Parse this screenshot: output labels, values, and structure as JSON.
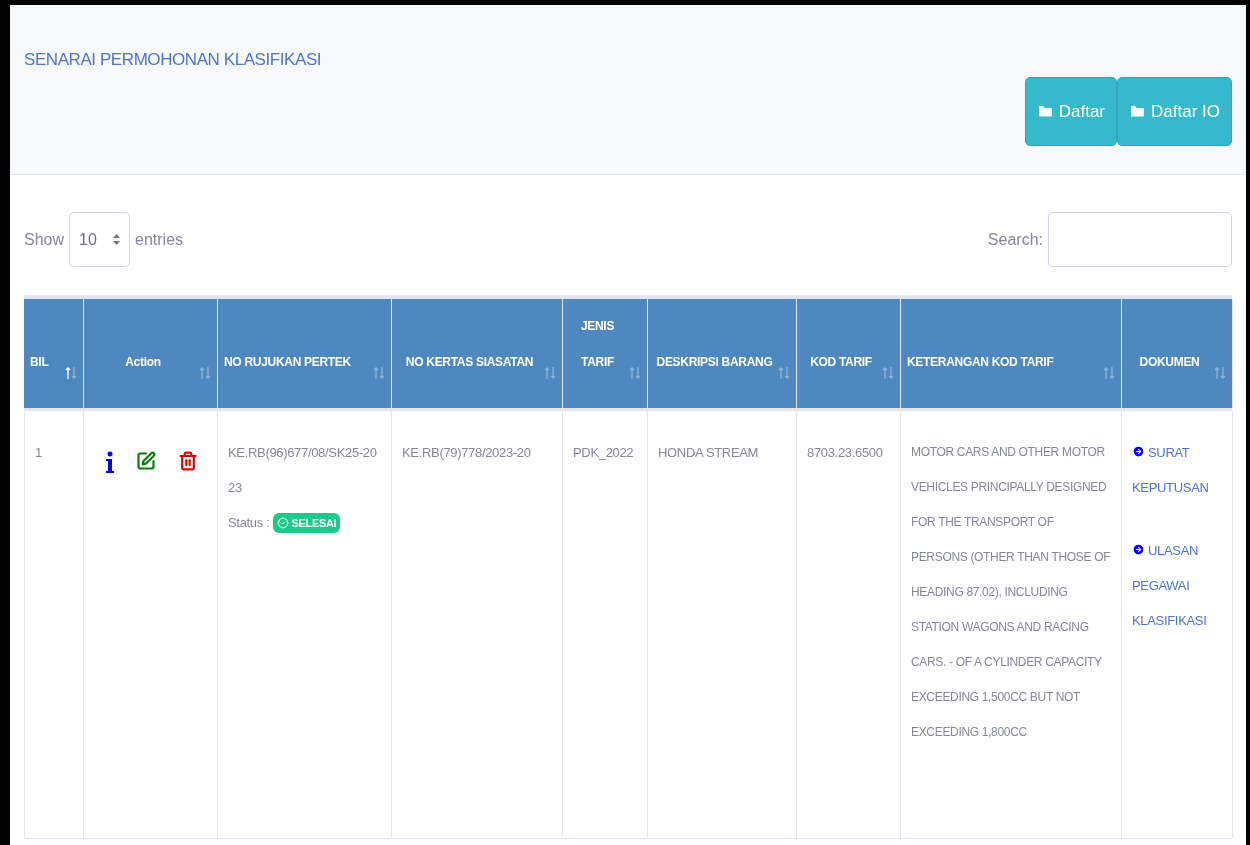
{
  "panel": {
    "title": "SENARAI PERMOHONAN KLASIFIKASI",
    "buttons": [
      "Daftar",
      "Daftar IO"
    ]
  },
  "table_controls": {
    "show_label": "Show",
    "page_size": "10",
    "entries_label": "entries",
    "search_label": "Search:"
  },
  "table": {
    "columns": [
      {
        "label": "BIL",
        "sorted": true
      },
      {
        "label": "Action",
        "sorted": false
      },
      {
        "label": "NO RUJUKAN PERTEK",
        "sorted": false
      },
      {
        "label": "NO KERTAS SIASATAN",
        "sorted": false
      },
      {
        "label": "JENIS TARIF",
        "sorted": false
      },
      {
        "label": "DESKRIPSI BARANG",
        "sorted": false
      },
      {
        "label": "KOD TARIF",
        "sorted": false
      },
      {
        "label": "KETERANGAN KOD TARIF",
        "sorted": false
      },
      {
        "label": "DOKUMEN",
        "sorted": false
      }
    ],
    "rows": [
      {
        "bil": "1",
        "no_rujukan": "KE.RB(96)677/08/SK25-2023",
        "status_label": "Status :",
        "status": "SELESAI",
        "no_kertas": "KE.RB(79)778/2023-20",
        "jenis_tarif": "PDK_2022",
        "deskripsi": "HONDA STREAM",
        "kod_tarif": "8703.23.6500",
        "keterangan": "MOTOR CARS AND OTHER MOTOR VEHICLES PRINCIPALLY DESIGNED FOR THE TRANSPORT OF PERSONS (OTHER THAN THOSE OF HEADING 87.02), INCLUDING STATION WAGONS AND RACING CARS. - OF A CYLINDER CAPACITY EXCEEDING 1,500CC BUT NOT EXCEEDING 1,800CC",
        "documents": [
          "SURAT KEPUTUSAN",
          "ULASAN PEGAWAI KLASIFIKASI"
        ]
      }
    ]
  }
}
